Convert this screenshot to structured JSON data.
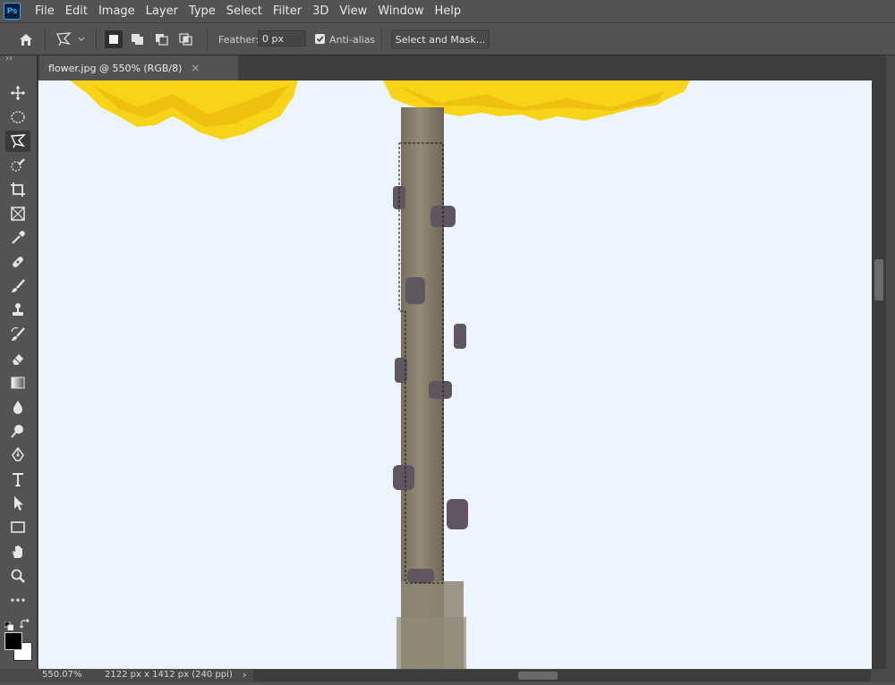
{
  "app": {
    "logo": "Ps"
  },
  "menu": [
    "File",
    "Edit",
    "Image",
    "Layer",
    "Type",
    "Select",
    "Filter",
    "3D",
    "View",
    "Window",
    "Help"
  ],
  "options": {
    "feather_label": "Feather:",
    "feather_value": "0 px",
    "antialias_label": "Anti-alias",
    "antialias_checked": true,
    "select_mask_label": "Select and Mask..."
  },
  "document": {
    "tab_title": "flower.jpg @ 550% (RGB/8)",
    "close_glyph": "×"
  },
  "tools": [
    "move-tool",
    "elliptical-marquee-tool",
    "polygonal-lasso-tool",
    "quick-selection-tool",
    "crop-tool",
    "frame-tool",
    "eyedropper-tool",
    "spot-healing-brush-tool",
    "brush-tool",
    "clone-stamp-tool",
    "history-brush-tool",
    "eraser-tool",
    "gradient-tool",
    "blur-tool",
    "dodge-tool",
    "pen-tool",
    "type-tool",
    "path-selection-tool",
    "rectangle-tool",
    "hand-tool",
    "zoom-tool",
    "edit-toolbar"
  ],
  "colors": {
    "foreground": "#000000",
    "background": "#ffffff",
    "canvas_bg": "#ecf5fd",
    "flower": "#f7d417",
    "stem": "#8a7d6b"
  },
  "toolbar_expand_glyph": "››",
  "status": {
    "zoom": "550.07%",
    "doc_info": "2122 px x 1412 px (240 ppi)",
    "arrow": "›"
  }
}
